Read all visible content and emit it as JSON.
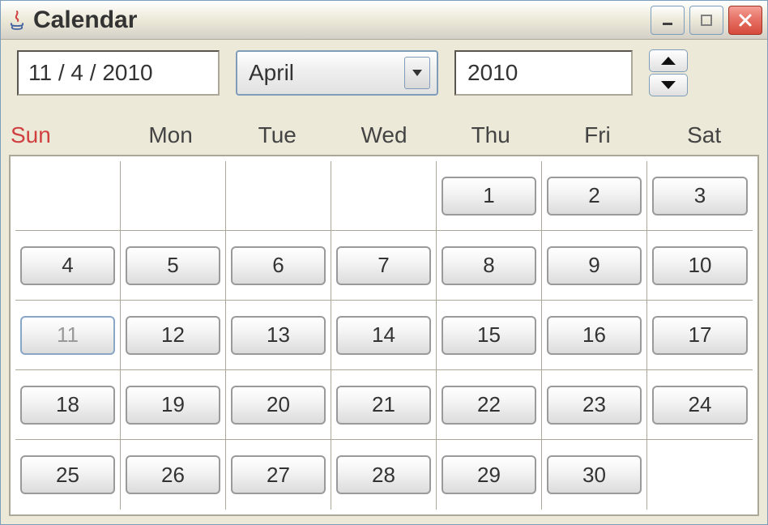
{
  "window": {
    "title": "Calendar"
  },
  "controls": {
    "date_value": "11 / 4 / 2010",
    "month_label": "April",
    "year_value": "2010"
  },
  "day_headers": {
    "sun": "Sun",
    "mon": "Mon",
    "tue": "Tue",
    "wed": "Wed",
    "thu": "Thu",
    "fri": "Fri",
    "sat": "Sat"
  },
  "calendar": {
    "selected_day": 11,
    "cells": [
      "",
      "",
      "",
      "",
      "1",
      "2",
      "3",
      "4",
      "5",
      "6",
      "7",
      "8",
      "9",
      "10",
      "11",
      "12",
      "13",
      "14",
      "15",
      "16",
      "17",
      "18",
      "19",
      "20",
      "21",
      "22",
      "23",
      "24",
      "25",
      "26",
      "27",
      "28",
      "29",
      "30",
      ""
    ]
  }
}
